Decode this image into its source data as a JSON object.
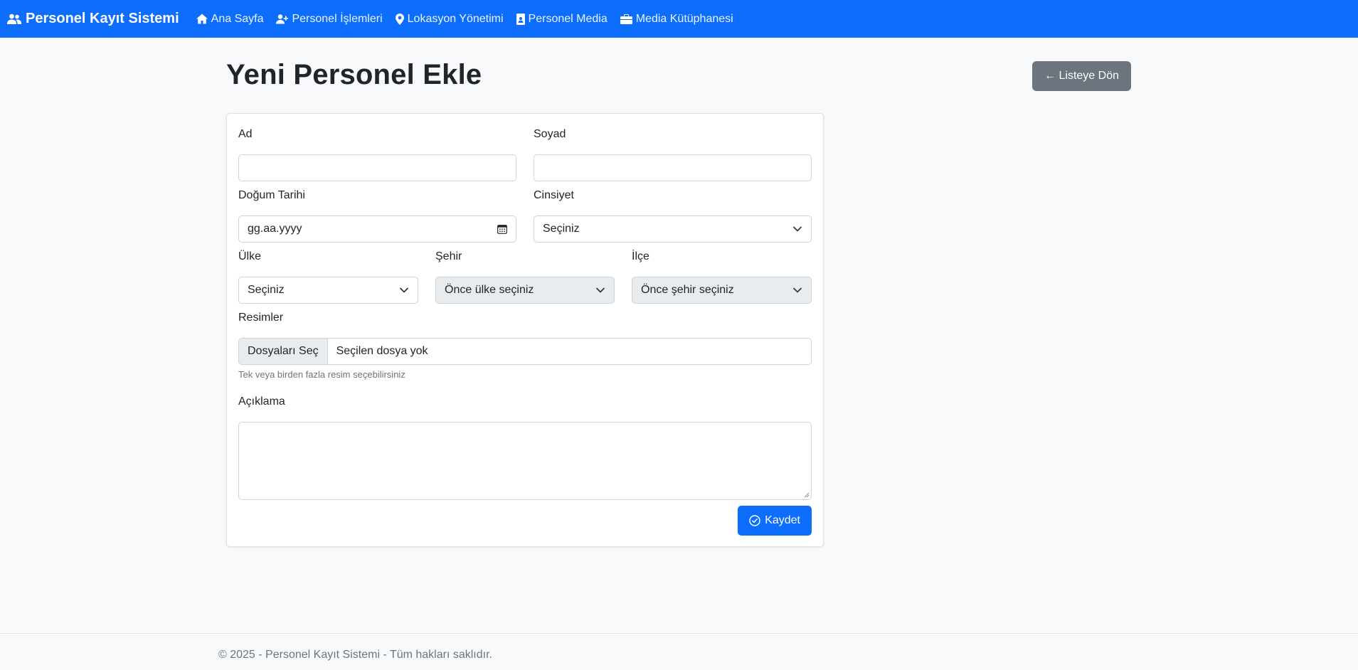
{
  "navbar": {
    "brand": "Personel Kayıt Sistemi",
    "links": [
      {
        "label": "Ana Sayfa",
        "icon": "house-icon"
      },
      {
        "label": "Personel İşlemleri",
        "icon": "person-plus-icon"
      },
      {
        "label": "Lokasyon Yönetimi",
        "icon": "geo-pin-icon"
      },
      {
        "label": "Personel Media",
        "icon": "person-badge-icon"
      },
      {
        "label": "Media Kütüphanesi",
        "icon": "briefcase-icon"
      }
    ]
  },
  "page": {
    "title": "Yeni Personel Ekle",
    "back_button": "← Listeye Dön"
  },
  "form": {
    "ad": {
      "label": "Ad",
      "value": ""
    },
    "soyad": {
      "label": "Soyad",
      "value": ""
    },
    "dogum": {
      "label": "Doğum Tarihi",
      "placeholder": "gg.aa.yyyy"
    },
    "cinsiyet": {
      "label": "Cinsiyet",
      "selected": "Seçiniz"
    },
    "ulke": {
      "label": "Ülke",
      "selected": "Seçiniz"
    },
    "sehir": {
      "label": "Şehir",
      "selected": "Önce ülke seçiniz",
      "disabled": true
    },
    "ilce": {
      "label": "İlçe",
      "selected": "Önce şehir seçiniz",
      "disabled": true
    },
    "resimler": {
      "label": "Resimler",
      "button": "Dosyaları Seç",
      "status": "Seçilen dosya yok",
      "help": "Tek veya birden fazla resim seçebilirsiniz"
    },
    "aciklama": {
      "label": "Açıklama",
      "value": ""
    },
    "save_button": "Kaydet"
  },
  "footer": {
    "text": "© 2025 - Personel Kayıt Sistemi - Tüm hakları saklıdır."
  },
  "colors": {
    "primary": "#0d6efd",
    "secondary": "#6c757d",
    "background": "#f8f9fa"
  }
}
